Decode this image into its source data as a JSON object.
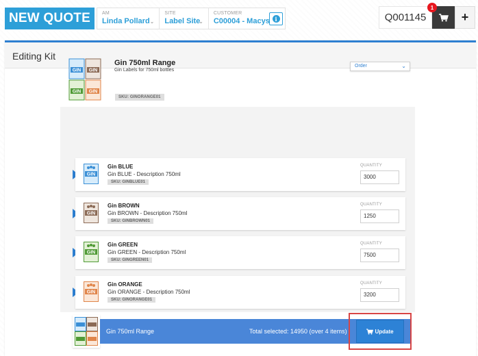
{
  "header": {
    "new_quote_label": "NEW QUOTE",
    "am": {
      "label": "AM",
      "value": "Linda Pollard"
    },
    "site": {
      "label": "SITE",
      "value": "Label Site"
    },
    "customer": {
      "label": "CUSTOMER",
      "value": "C00004 - Macys"
    },
    "info_icon": "info-icon",
    "quote_number": "Q001145",
    "cart_count": "1",
    "cart_icon": "cart-icon",
    "add_label": "+"
  },
  "panel": {
    "title": "Editing Kit",
    "kit": {
      "name": "Gin 750ml Range",
      "description": "Gin Labels for 750ml bottles",
      "sku": "SKU: GINORANGE01",
      "order_select": "Order"
    },
    "items": [
      {
        "name": "Gin BLUE",
        "description": "Gin BLUE - Description 750ml",
        "sku": "SKU: GINBLUE01",
        "quantity_label": "QUANTITY",
        "quantity": "3000",
        "color": "#3a8fd6"
      },
      {
        "name": "Gin BROWN",
        "description": "Gin BROWN - Description 750ml",
        "sku": "SKU: GINBROWN01",
        "quantity_label": "QUANTITY",
        "quantity": "1250",
        "color": "#8b6a55"
      },
      {
        "name": "Gin GREEN",
        "description": "Gin GREEN - Description 750ml",
        "sku": "SKU: GINGREEN01",
        "quantity_label": "QUANTITY",
        "quantity": "7500",
        "color": "#4f9a35"
      },
      {
        "name": "Gin ORANGE",
        "description": "Gin ORANGE - Description 750ml",
        "sku": "SKU: GINORANGE01",
        "quantity_label": "QUANTITY",
        "quantity": "3200",
        "color": "#e0854a"
      }
    ],
    "summary": {
      "name": "Gin 750ml Range",
      "total": "Total selected: 14950 (over 4 items)",
      "update_label": "Update"
    }
  },
  "colors": {
    "accent": "#2d9fd8",
    "primary": "#2d7fd1",
    "bar": "#4a86d8",
    "highlight": "#d84545"
  }
}
